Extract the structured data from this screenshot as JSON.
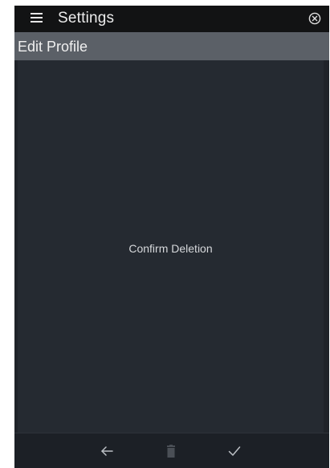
{
  "header": {
    "title": "Settings",
    "menu_icon": "hamburger-menu-icon",
    "close_icon": "circled-x-icon"
  },
  "subheader": {
    "title": "Edit Profile"
  },
  "content": {
    "message": "Confirm Deletion"
  },
  "bottom_bar": {
    "back_icon": "arrow-left-icon",
    "delete_icon": "trash-icon",
    "delete_disabled": true,
    "confirm_icon": "checkmark-icon"
  },
  "colors": {
    "topbar_bg": "#121314",
    "subheader_bg": "#5b6067",
    "content_bg": "#252a31",
    "bottombar_bg": "#1c2026",
    "text_primary": "#ececec",
    "disabled_icon": "#4a4f56"
  }
}
